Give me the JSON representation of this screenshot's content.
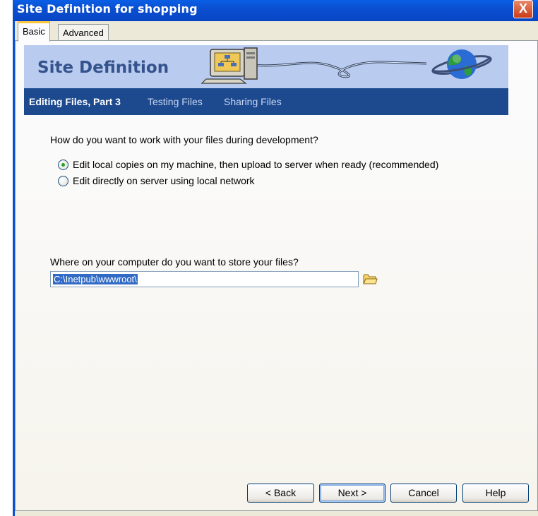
{
  "window": {
    "title": "Site Definition for shopping",
    "close_label": "X"
  },
  "tabs": [
    {
      "label": "Basic",
      "active": true
    },
    {
      "label": "Advanced",
      "active": false
    }
  ],
  "banner": {
    "title": "Site Definition"
  },
  "steps": [
    {
      "label": "Editing Files, Part 3",
      "current": true
    },
    {
      "label": "Testing Files",
      "current": false
    },
    {
      "label": "Sharing Files",
      "current": false
    }
  ],
  "question1": "How do you want to work with your files during development?",
  "options": [
    {
      "label": "Edit local copies on my machine, then upload to server when ready (recommended)",
      "checked": true
    },
    {
      "label": "Edit directly on server using local network",
      "checked": false
    }
  ],
  "question2": "Where on your computer do you want to store your files?",
  "path_value": "C:\\Inetpub\\wwwroot\\",
  "buttons": {
    "back": "< Back",
    "next": "Next >",
    "cancel": "Cancel",
    "help": "Help"
  },
  "icons": {
    "close": "close-icon",
    "folder": "folder-icon",
    "computer": "computer-icon",
    "globe": "globe-icon"
  },
  "colors": {
    "titlebar": "#0a4fd0",
    "banner": "#b9cbee",
    "steps_bar": "#1d4a8f",
    "banner_title": "#34538d",
    "selection": "#316ac5"
  }
}
